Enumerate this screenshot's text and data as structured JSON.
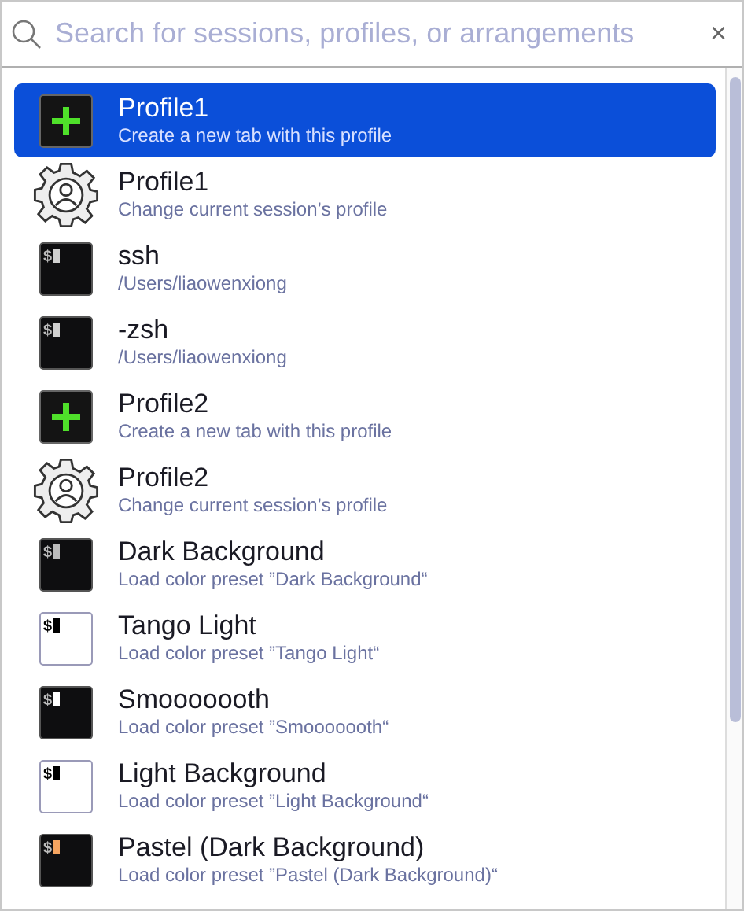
{
  "search": {
    "placeholder": "Search for sessions, profiles, or arrangements",
    "clear": "×"
  },
  "items": [
    {
      "kind": "new-tab",
      "title": "Profile1",
      "subtitle": "Create a new tab with this profile",
      "selected": true
    },
    {
      "kind": "profile",
      "title": "Profile1",
      "subtitle": "Change current session’s profile",
      "selected": false
    },
    {
      "kind": "terminal-dark",
      "prompt": "$",
      "color": "#d0d0d0",
      "title": "ssh",
      "subtitle": "/Users/liaowenxiong",
      "selected": false
    },
    {
      "kind": "terminal-dark",
      "prompt": "$",
      "color": "#d0d0d0",
      "title": "-zsh",
      "subtitle": "/Users/liaowenxiong",
      "selected": false
    },
    {
      "kind": "new-tab",
      "title": "Profile2",
      "subtitle": "Create a new tab with this profile",
      "selected": false
    },
    {
      "kind": "profile",
      "title": "Profile2",
      "subtitle": "Change current session’s profile",
      "selected": false
    },
    {
      "kind": "terminal-dark",
      "prompt": "$",
      "color": "#bbbbbb",
      "title": "Dark Background",
      "subtitle": "Load color preset ”Dark Background“",
      "selected": false
    },
    {
      "kind": "terminal-light",
      "prompt": "$",
      "color": "#000000",
      "title": "Tango Light",
      "subtitle": "Load color preset ”Tango Light“",
      "selected": false
    },
    {
      "kind": "terminal-dark",
      "prompt": "$",
      "color": "#ffffff",
      "title": "Smooooooth",
      "subtitle": "Load color preset ”Smooooooth“",
      "selected": false
    },
    {
      "kind": "terminal-light",
      "prompt": "$",
      "color": "#000000",
      "title": "Light Background",
      "subtitle": "Load color preset ”Light Background“",
      "selected": false
    },
    {
      "kind": "terminal-dark",
      "prompt": "$",
      "color": "#f5a460",
      "title": "Pastel (Dark Background)",
      "subtitle": "Load color preset ”Pastel (Dark Background)“",
      "selected": false
    }
  ]
}
